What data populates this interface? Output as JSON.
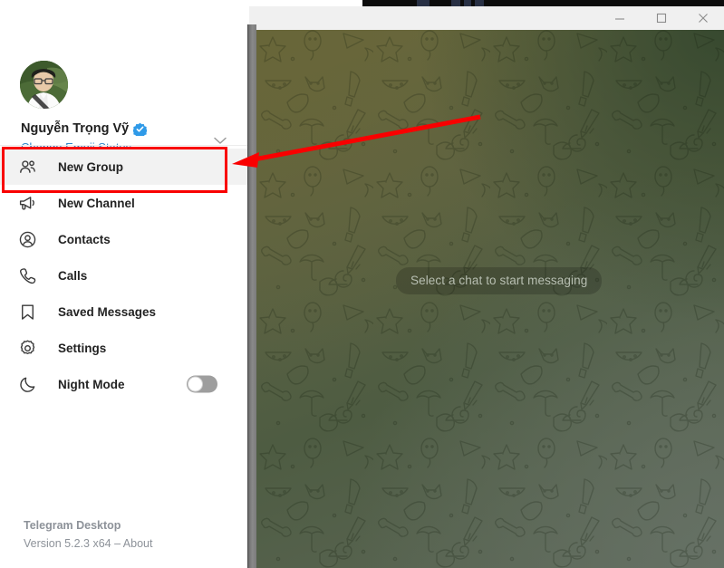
{
  "app": {
    "name": "Telegram Desktop",
    "version_line": "Version 5.2.3 x64 – About"
  },
  "titlebar": {
    "minimize_label": "Minimize",
    "maximize_label": "Maximize",
    "close_label": "Close"
  },
  "profile": {
    "name": "Nguyễn Trọng Vỹ",
    "verified_badge": "verified-badge-icon",
    "emoji_status_link": "Change Emoji Status",
    "expand_icon": "chevron-down-icon",
    "avatar_icon": "user-avatar-photo"
  },
  "menu": {
    "items": [
      {
        "label": "New Group",
        "icon": "new-group-icon",
        "active": true,
        "toggle": null
      },
      {
        "label": "New Channel",
        "icon": "new-channel-icon",
        "active": false,
        "toggle": null
      },
      {
        "label": "Contacts",
        "icon": "contacts-icon",
        "active": false,
        "toggle": null
      },
      {
        "label": "Calls",
        "icon": "calls-icon",
        "active": false,
        "toggle": null
      },
      {
        "label": "Saved Messages",
        "icon": "saved-messages-icon",
        "active": false,
        "toggle": null
      },
      {
        "label": "Settings",
        "icon": "settings-gear-icon",
        "active": false,
        "toggle": null
      },
      {
        "label": "Night Mode",
        "icon": "night-mode-moon-icon",
        "active": false,
        "toggle": "off"
      }
    ]
  },
  "chat": {
    "empty_state": "Select a chat to start messaging"
  },
  "annotation": {
    "highlight_target": "New Group",
    "arrow_color": "#f90000",
    "box_color": "#f90000"
  },
  "colors": {
    "accent_blue": "#2f87c9",
    "verified_blue": "#2f9ae8",
    "highlight_red": "#f90000",
    "active_row": "#f2f2f2",
    "chat_bg": "#5d6343"
  }
}
